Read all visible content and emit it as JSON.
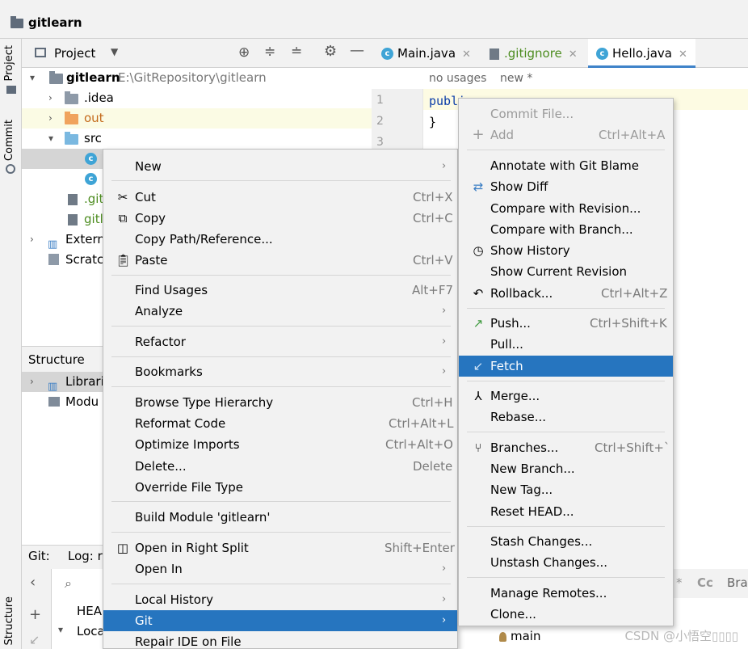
{
  "window": {
    "project_name": "gitlearn",
    "left_tabs": {
      "project": "Project",
      "commit": "Commit",
      "structure": "Structure"
    }
  },
  "project_panel": {
    "title": "Project",
    "tree": {
      "root_name": "gitlearn",
      "root_path": "E:\\GitRepository\\gitlearn",
      "idea": ".idea",
      "out": "out",
      "src": "src",
      "gitignore_trunc": ".git",
      "gitlearn_trunc": "gitl",
      "external_trunc": "Extern",
      "scratch_trunc": "Scratc"
    }
  },
  "structure_panel": {
    "title": "Structure",
    "items": [
      "Librari",
      "Modu"
    ]
  },
  "git_panel": {
    "tab_git": "Git:",
    "tab_log": "Log: r",
    "head": "HEA",
    "local": "Loca"
  },
  "editor": {
    "tabs": [
      {
        "label": "Main.java",
        "color": "#000000"
      },
      {
        "label": ".gitignore",
        "color": "#4c8c1f"
      },
      {
        "label": "Hello.java",
        "color": "#000000"
      }
    ],
    "hint_usages": "no usages",
    "hint_new": "new *",
    "line_numbers": [
      "1",
      "2",
      "3"
    ],
    "code_line1": "publi",
    "code_line2": "}",
    "search_hint": "Cc",
    "search_star": "*",
    "branch_trunc": "Bra",
    "main_branch": "main"
  },
  "context_menu": {
    "items": [
      {
        "label": "New",
        "mnemonic_index": 0,
        "submenu": true
      },
      {
        "label": "Cut",
        "shortcut": "Ctrl+X",
        "icon": "scissors-icon"
      },
      {
        "label": "Copy",
        "shortcut": "Ctrl+C",
        "icon": "copy-icon"
      },
      {
        "label": "Copy Path/Reference..."
      },
      {
        "label": "Paste",
        "shortcut": "Ctrl+V",
        "icon": "clipboard-icon"
      },
      {
        "label": "Find Usages",
        "shortcut": "Alt+F7"
      },
      {
        "label": "Analyze",
        "submenu": true
      },
      {
        "label": "Refactor",
        "submenu": true
      },
      {
        "label": "Bookmarks",
        "submenu": true
      },
      {
        "label": "Browse Type Hierarchy",
        "shortcut": "Ctrl+H"
      },
      {
        "label": "Reformat Code",
        "shortcut": "Ctrl+Alt+L"
      },
      {
        "label": "Optimize Imports",
        "shortcut": "Ctrl+Alt+O"
      },
      {
        "label": "Delete...",
        "shortcut": "Delete"
      },
      {
        "label": "Override File Type"
      },
      {
        "label": "Build Module 'gitlearn'"
      },
      {
        "label": "Open in Right Split",
        "shortcut": "Shift+Enter",
        "icon": "split-icon"
      },
      {
        "label": "Open In",
        "submenu": true
      },
      {
        "label": "Local History",
        "submenu": true
      },
      {
        "label": "Git",
        "submenu": true,
        "selected": true
      },
      {
        "label": "Repair IDE on File"
      }
    ]
  },
  "git_menu": {
    "items": [
      {
        "label": "Commit File...",
        "disabled": true
      },
      {
        "label": "Add",
        "shortcut": "Ctrl+Alt+A",
        "disabled": true,
        "icon": "plus-icon"
      },
      {
        "label": "Annotate with Git Blame"
      },
      {
        "label": "Show Diff",
        "icon": "diff-arrows-icon"
      },
      {
        "label": "Compare with Revision..."
      },
      {
        "label": "Compare with Branch..."
      },
      {
        "label": "Show History",
        "icon": "clock-icon"
      },
      {
        "label": "Show Current Revision"
      },
      {
        "label": "Rollback...",
        "shortcut": "Ctrl+Alt+Z",
        "icon": "undo-icon"
      },
      {
        "label": "Push...",
        "shortcut": "Ctrl+Shift+K",
        "icon": "push-arrow-icon"
      },
      {
        "label": "Pull..."
      },
      {
        "label": "Fetch",
        "selected": true,
        "icon": "fetch-arrow-icon"
      },
      {
        "label": "Merge...",
        "icon": "merge-icon"
      },
      {
        "label": "Rebase..."
      },
      {
        "label": "Branches...",
        "shortcut": "Ctrl+Shift+`",
        "icon": "branch-icon"
      },
      {
        "label": "New Branch..."
      },
      {
        "label": "New Tag..."
      },
      {
        "label": "Reset HEAD..."
      },
      {
        "label": "Stash Changes..."
      },
      {
        "label": "Unstash Changes..."
      },
      {
        "label": "Manage Remotes..."
      },
      {
        "label": "Clone..."
      }
    ]
  },
  "watermark": "CSDN @小悟空▯▯▯▯",
  "colors": {
    "selection": "#2675bf",
    "panel_bg": "#f2f2f2",
    "out_folder": "#f0a35e",
    "src_folder": "#7ab8e0",
    "class_icon": "#3fa4d6"
  }
}
